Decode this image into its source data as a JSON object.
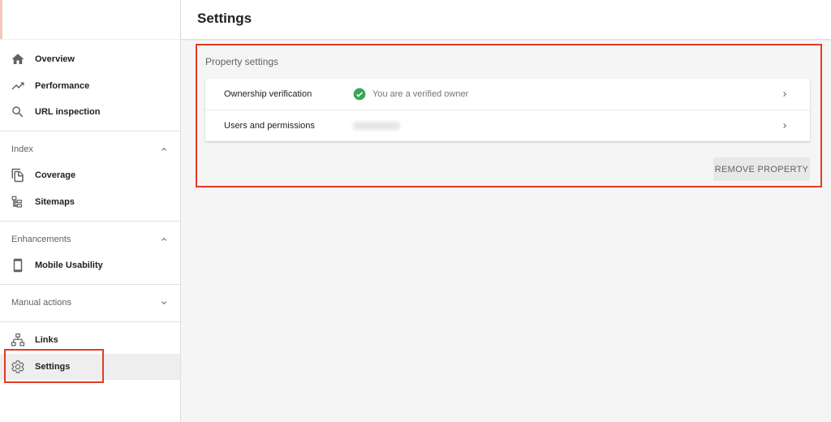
{
  "header": {
    "title": "Settings"
  },
  "sidebar": {
    "main_items": [
      {
        "label": "Overview",
        "icon": "home-icon"
      },
      {
        "label": "Performance",
        "icon": "trending-up-icon"
      },
      {
        "label": "URL inspection",
        "icon": "search-icon"
      }
    ],
    "sections": [
      {
        "label": "Index",
        "expanded": true,
        "items": [
          {
            "label": "Coverage",
            "icon": "copy-icon"
          },
          {
            "label": "Sitemaps",
            "icon": "sitemap-icon"
          }
        ]
      },
      {
        "label": "Enhancements",
        "expanded": true,
        "items": [
          {
            "label": "Mobile Usability",
            "icon": "smartphone-icon"
          }
        ]
      },
      {
        "label": "Manual actions",
        "expanded": false,
        "items": []
      }
    ],
    "bottom_items": [
      {
        "label": "Links",
        "icon": "links-icon"
      },
      {
        "label": "Settings",
        "icon": "gear-icon",
        "selected": true
      }
    ]
  },
  "property_settings": {
    "title": "Property settings",
    "rows": [
      {
        "label": "Ownership verification",
        "value": "You are a verified owner",
        "status_icon": "check-circle-icon"
      },
      {
        "label": "Users and permissions",
        "value": ""
      }
    ],
    "remove_button": "REMOVE PROPERTY"
  },
  "colors": {
    "verified": "#34a853",
    "annotation": "#e53a23",
    "selected_bg": "#eeeeee"
  }
}
